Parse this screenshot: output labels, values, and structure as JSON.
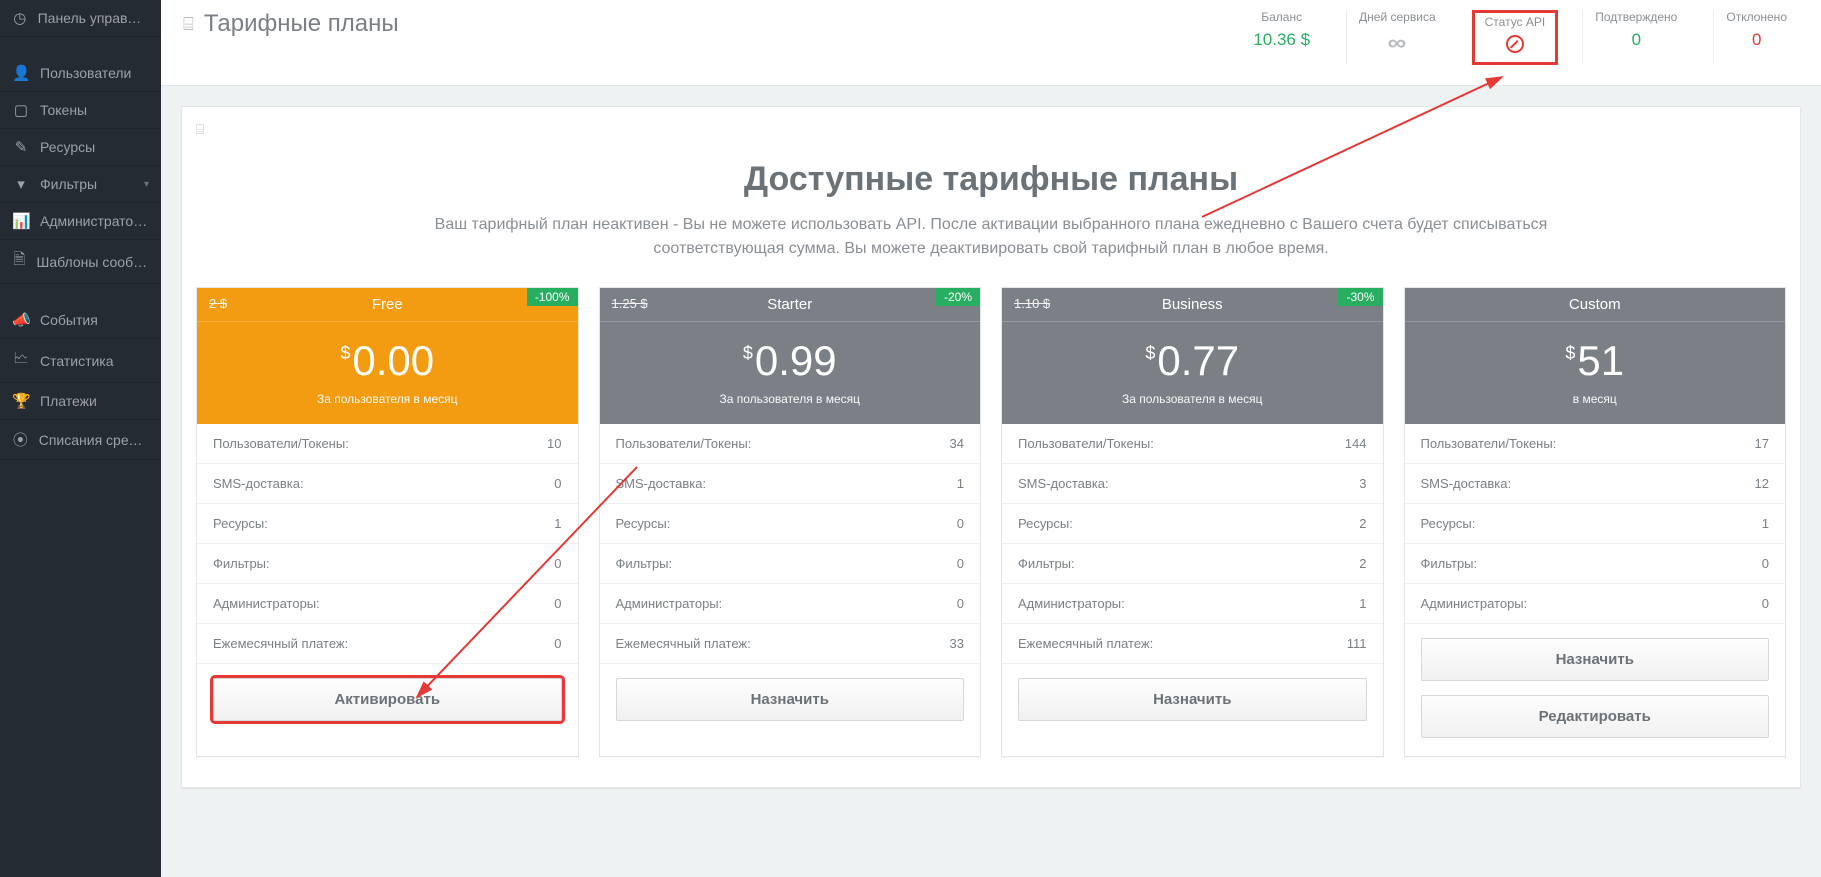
{
  "sidebar": {
    "items": [
      {
        "icon": "◷",
        "label": "Панель управления"
      },
      {
        "spacer": true
      },
      {
        "icon": "👤",
        "label": "Пользователи"
      },
      {
        "icon": "▢",
        "label": "Токены"
      },
      {
        "icon": "✎",
        "label": "Ресурсы"
      },
      {
        "icon": "▾",
        "label": "Фильтры",
        "chevron": true
      },
      {
        "icon": "📊",
        "label": "Администраторы"
      },
      {
        "icon": "🗎",
        "label": "Шаблоны сообщений"
      },
      {
        "spacer": true
      },
      {
        "icon": "📣",
        "label": "События"
      },
      {
        "icon": "🗠",
        "label": "Статистика"
      },
      {
        "icon": "🏆",
        "label": "Платежи"
      },
      {
        "icon": "⦿",
        "label": "Списания средств"
      }
    ]
  },
  "header": {
    "title": "Тарифные планы",
    "stats": [
      {
        "label": "Баланс",
        "value": "10.36 $",
        "cls": "green"
      },
      {
        "label": "Дней сервиса",
        "value": "∞",
        "infinity": true
      },
      {
        "label": "Статус API",
        "value": "forbid",
        "highlight": true
      },
      {
        "label": "Подтверждено",
        "value": "0",
        "cls": "green"
      },
      {
        "label": "Отклонено",
        "value": "0",
        "cls": "red"
      }
    ]
  },
  "section": {
    "title": "Доступные тарифные планы",
    "desc": "Ваш тарифный план неактивен - Вы не можете использовать API. После активации выбранного плана ежедневно с Вашего счета будет списываться соответствующая сумма. Вы можете деактивировать свой тарифный план в любое время."
  },
  "feature_labels": {
    "users": "Пользователи/Токены:",
    "sms": "SMS-доставка:",
    "resources": "Ресурсы:",
    "filters": "Фильтры:",
    "admins": "Администраторы:",
    "monthly": "Ежемесячный платеж:"
  },
  "plans": [
    {
      "name": "Free",
      "old": "2 $",
      "discount": "-100%",
      "price": "0.00",
      "period": "За пользователя в месяц",
      "theme": "orange",
      "features": {
        "users": "10",
        "sms": "0",
        "resources": "1",
        "filters": "0",
        "admins": "0",
        "monthly": "0"
      },
      "buttons": [
        {
          "label": "Активировать",
          "highlight": true
        }
      ]
    },
    {
      "name": "Starter",
      "old": "1.25 $",
      "discount": "-20%",
      "price": "0.99",
      "period": "За пользователя в месяц",
      "theme": "grey",
      "features": {
        "users": "34",
        "sms": "1",
        "resources": "0",
        "filters": "0",
        "admins": "0",
        "monthly": "33"
      },
      "buttons": [
        {
          "label": "Назначить"
        }
      ]
    },
    {
      "name": "Business",
      "old": "1.10 $",
      "discount": "-30%",
      "price": "0.77",
      "period": "За пользователя в месяц",
      "theme": "grey",
      "features": {
        "users": "144",
        "sms": "3",
        "resources": "2",
        "filters": "2",
        "admins": "1",
        "monthly": "111"
      },
      "buttons": [
        {
          "label": "Назначить"
        }
      ]
    },
    {
      "name": "Custom",
      "old": "",
      "discount": "",
      "price": "51",
      "period": "в месяц",
      "theme": "grey",
      "features": {
        "users": "17",
        "sms": "12",
        "resources": "1",
        "filters": "0",
        "admins": "0"
      },
      "buttons": [
        {
          "label": "Назначить"
        },
        {
          "label": "Редактировать"
        }
      ]
    }
  ]
}
